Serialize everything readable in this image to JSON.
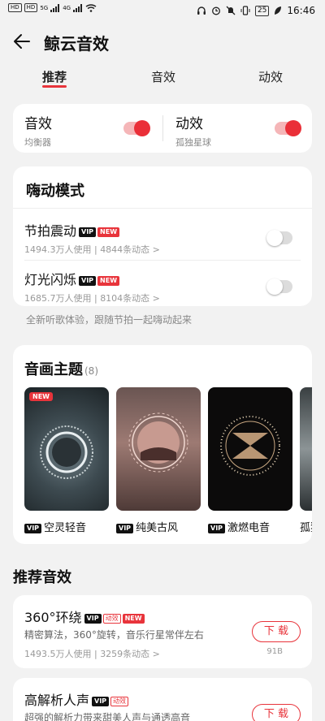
{
  "status_bar": {
    "left": [
      "HD",
      "HD",
      "5G",
      "4G"
    ],
    "battery": "25",
    "time": "16:46"
  },
  "header": {
    "title": "鲸云音效"
  },
  "tabs": [
    {
      "label": "推荐",
      "active": true
    },
    {
      "label": "音效",
      "active": false
    },
    {
      "label": "动效",
      "active": false
    }
  ],
  "quick_toggles": [
    {
      "label": "音效",
      "sub": "均衡器",
      "on": true
    },
    {
      "label": "动效",
      "sub": "孤独星球",
      "on": true
    }
  ],
  "hype_mode": {
    "title": "嗨动模式",
    "rows": [
      {
        "name": "节拍震动",
        "badges": [
          "VIP",
          "NEW"
        ],
        "meta": "1494.3万人使用 | 4844条动态 >",
        "on": false
      },
      {
        "name": "灯光闪烁",
        "badges": [
          "VIP",
          "NEW"
        ],
        "meta": "1685.7万人使用 | 8104条动态 >",
        "on": false
      }
    ],
    "hint": "全新听歌体验，跟随节拍一起嗨动起来"
  },
  "themes": {
    "title": "音画主题",
    "count": "(8)",
    "new_label": "NEW",
    "items": [
      {
        "label": "空灵轻音",
        "badge": "VIP"
      },
      {
        "label": "纯美古风",
        "badge": "VIP"
      },
      {
        "label": "激燃电音",
        "badge": "VIP"
      },
      {
        "label": "孤独",
        "badge": ""
      }
    ]
  },
  "recommended": {
    "title": "推荐音效",
    "items": [
      {
        "name": "360°环绕",
        "badges": [
          "VIP",
          "动效",
          "NEW"
        ],
        "desc": "精密算法，360°旋转，音乐行星常伴左右",
        "meta": "1493.5万人使用 | 3259条动态 >",
        "button": "下 载",
        "size": "91B"
      },
      {
        "name": "高解析人声",
        "badges": [
          "VIP",
          "动效"
        ],
        "desc": "超强的解析力带来甜美人声与通透高音",
        "meta": "",
        "button": "下 载",
        "size": ""
      }
    ]
  },
  "colors": {
    "accent": "#e8343b"
  }
}
